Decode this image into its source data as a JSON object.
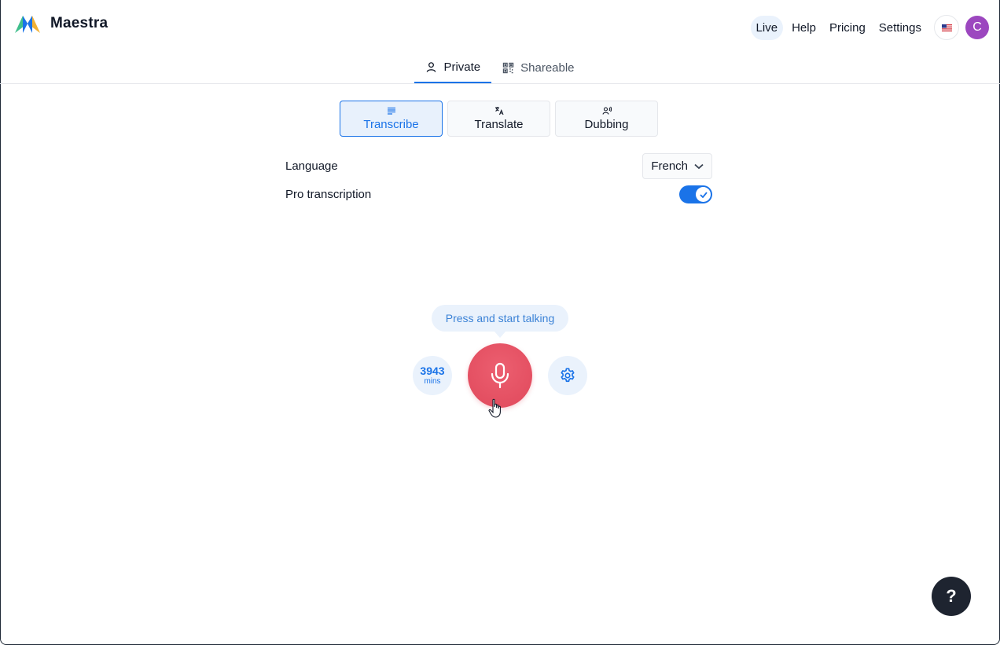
{
  "brand": {
    "name": "Maestra"
  },
  "nav": {
    "items": [
      {
        "label": "Live",
        "active": true
      },
      {
        "label": "Help"
      },
      {
        "label": "Pricing"
      },
      {
        "label": "Settings"
      }
    ],
    "avatar_initial": "C"
  },
  "tabs": [
    {
      "label": "Private",
      "icon": "person-icon",
      "active": true
    },
    {
      "label": "Shareable",
      "icon": "qr-code-icon"
    }
  ],
  "modes": [
    {
      "label": "Transcribe",
      "icon": "lines-icon",
      "active": true
    },
    {
      "label": "Translate",
      "icon": "translate-icon"
    },
    {
      "label": "Dubbing",
      "icon": "voice-icon"
    }
  ],
  "settings": {
    "language_label": "Language",
    "language_value": "French",
    "pro_label": "Pro transcription",
    "pro_enabled": true
  },
  "recorder": {
    "tooltip": "Press and start talking",
    "minutes_value": "3943",
    "minutes_unit": "mins"
  },
  "help_fab": "?",
  "colors": {
    "accent": "#1a73e8",
    "mic": "#e0485b",
    "avatar": "#9c47bf",
    "fab": "#1e2430"
  }
}
